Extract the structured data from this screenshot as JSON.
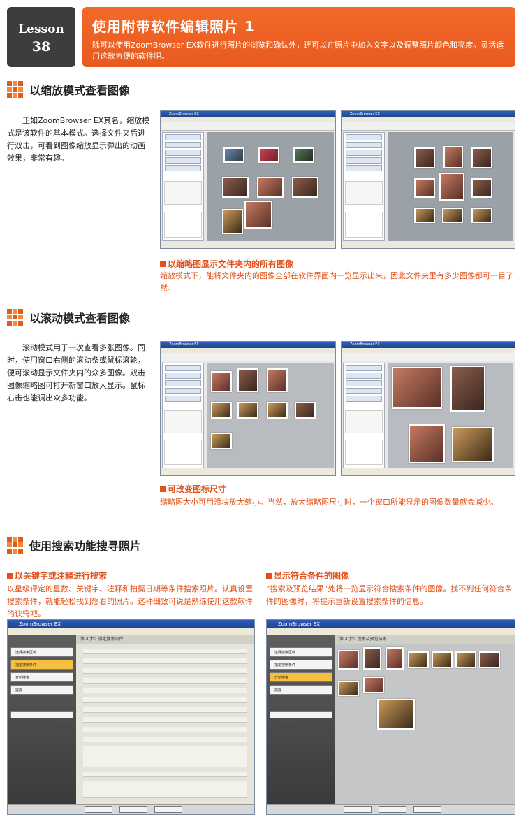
{
  "header": {
    "lesson_label": "Lesson",
    "lesson_number": "38",
    "title": "使用附带软件编辑照片 1",
    "intro": "除可以使用ZoomBrowser EX软件进行照片的浏览和确认外，还可以在照片中加入文字以及调整照片颜色和亮度。灵活运用这款方便的软件吧。"
  },
  "section1": {
    "heading": "以缩放模式查看图像",
    "body": "正如ZoomBrowser EX其名，缩放模式是该软件的基本模式。选择文件夹后进行双击，可看到图像缩放显示弹出的动画效果，非常有趣。",
    "caption_title": "以缩略图显示文件夹内的所有图像",
    "caption_text": "缩放模式下，能将文件夹内的图像全部在软件界面内一览显示出来，因此文件夹里有多少图像都可一目了然。"
  },
  "section2": {
    "heading": "以滚动模式查看图像",
    "body": "滚动模式用于一次查看多张图像。同时，使用窗口右侧的滚动条或鼠标滚轮，便可滚动显示文件夹内的众多图像。双击图像缩略图可打开新窗口放大显示。鼠标右击也能调出众多功能。",
    "caption_title": "可改变图标尺寸",
    "caption_text": "缩略图大小可用滑块放大缩小。当然，放大缩略图尺寸时，一个窗口所能显示的图像数量就会减少。"
  },
  "section3": {
    "heading": "使用搜索功能搜寻照片",
    "left_title": "以关键字或注释进行搜索",
    "left_text": "以星级评定的星数、关键字、注释和拍摄日期等条件搜索照片。认真设置搜索条件，就能轻松找到想看的照片。这种细致可说是熟练使用这款软件的诀窍吧。",
    "right_title": "显示符合条件的图像",
    "right_text": "“搜索及预览结果”处将一览显示符合搜索条件的图像。找不到任何符合条件的图像时，将提示重新设置搜索条件的信息。"
  },
  "screens": {
    "app_title": "ZoomBrowser EX",
    "step_title_left": "第 2 步：指定搜索条件",
    "step_title_right": "第 3 步：搜索及预览结果",
    "steps": [
      "选择搜索区域",
      "指定搜索条件",
      "开始搜索",
      "完成"
    ]
  }
}
